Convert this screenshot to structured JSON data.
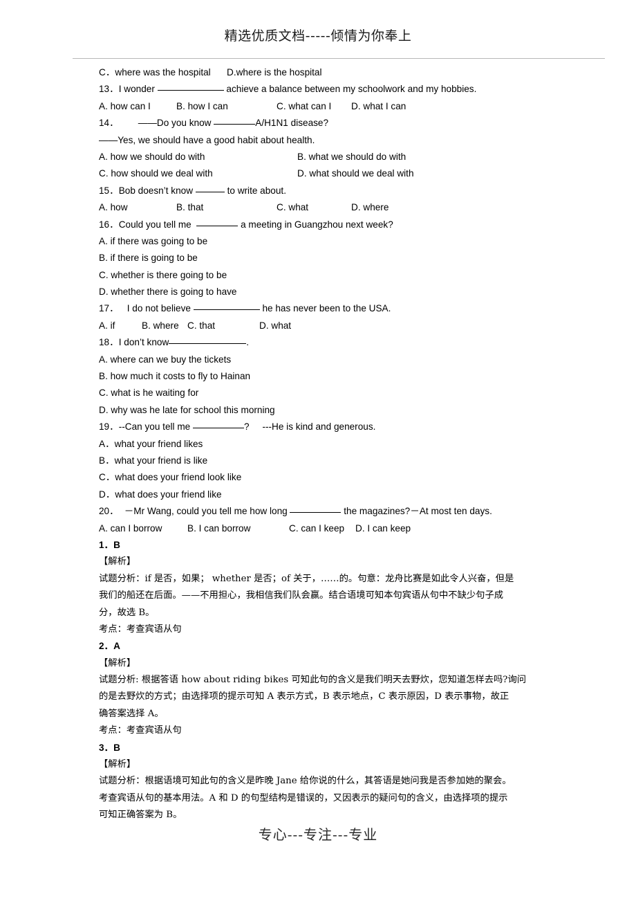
{
  "header": {
    "watermark": "精选优质文档-----倾情为你奉上"
  },
  "footer": {
    "watermark": "专心---专注---专业"
  },
  "document": {
    "carryover_options": {
      "c": "C．where was the hospital",
      "d": "D.where is the hospital"
    },
    "questions": [
      {
        "number": "13．",
        "stem_before": "I wonder ",
        "stem_after": " achieve a balance between my schoolwork and my hobbies.",
        "blank": "b-xl",
        "options_inline": [
          "A. how can I",
          "B. how I can",
          "C. what can I",
          "D. what I can"
        ]
      },
      {
        "number": "14．",
        "stem_before": "——Do you know ",
        "stem_after": "A/H1N1 disease?",
        "blank": "b-md",
        "second_line": "——Yes, we should have a good habit about health.",
        "options_two_col": [
          [
            "A. how we should do with",
            "B. what we should do with"
          ],
          [
            "C. how should we deal with",
            "D. what should we deal with"
          ]
        ]
      },
      {
        "number": "15．",
        "stem_before": "Bob doesn’t know ",
        "stem_after": " to write about.",
        "blank": "b-sm",
        "options_inline": [
          "A. how",
          "B. that",
          "C. what",
          "D. where"
        ]
      },
      {
        "number": "16．",
        "stem_before": "Could you tell me  ",
        "stem_after": " a meeting in Guangzhou next week?",
        "blank": "b-md",
        "options_stacked": [
          "A. if there was going to be",
          "B. if there is going to be",
          "C. whether is there going to be",
          "D. whether there is going to have"
        ]
      },
      {
        "number": "17．",
        "stem_before": "I do not believe ",
        "stem_after": " he has never been to the USA.",
        "blank": "b-xl",
        "options_inline": [
          "A. if",
          "B. where",
          "C. that",
          "D. what"
        ]
      },
      {
        "number": "18．",
        "stem_before": "I don’t know",
        "stem_after": ".",
        "blank": "b-xxl",
        "options_stacked": [
          "A. where can we buy the tickets",
          "B. how much it costs to fly to Hainan",
          "C. what is he waiting for",
          "D. why was he late for school this morning"
        ]
      },
      {
        "number": "19．",
        "stem_before": "--Can you tell me ",
        "stem_after": "?     ---He is kind and generous.",
        "blank": "b-lg",
        "options_stacked": [
          "A．what your friend likes",
          "B．what your friend is like",
          "C．what does your friend look like",
          "D．what does your friend like"
        ]
      },
      {
        "number": "20．",
        "stem_before": "－Mr Wang, could you tell me how long ",
        "stem_after": " the magazines?－At most ten days.",
        "blank": "b-lg",
        "options_inline": [
          "A. can I borrow",
          "B. I can borrow",
          "C. can I keep",
          "D. I can keep"
        ]
      }
    ],
    "answers": [
      {
        "head": "1．B",
        "label": "【解析】",
        "analysis_lines": [
          "试题分析：if 是否，如果； whether 是否；of 关于，……的。句意：龙舟比赛是如此令人兴奋，但是",
          "我们的船还在后面。——不用担心，我相信我们队会赢。结合语境可知本句宾语从句中不缺少句子成",
          "分，故选 B。"
        ],
        "point": "考点：考查宾语从句"
      },
      {
        "head": "2．A",
        "label": "【解析】",
        "analysis_lines": [
          "试题分析: 根据答语 how about riding bikes 可知此句的含义是我们明天去野炊，您知道怎样去吗?询问",
          "的是去野炊的方式；由选择项的提示可知 A 表示方式，B 表示地点，C 表示原因，D 表示事物，故正",
          "确答案选择 A。"
        ],
        "point": "考点：考查宾语从句"
      },
      {
        "head": "3．B",
        "label": "【解析】",
        "analysis_lines": [
          "试题分析：根据语境可知此句的含义是昨晚 Jane 给你说的什么，其答语是她问我是否参加她的聚会。",
          "考查宾语从句的基本用法。A 和 D 的句型结构是错误的，又因表示的疑问句的含义，由选择项的提示",
          "可知正确答案为 B。"
        ],
        "point": ""
      }
    ]
  }
}
